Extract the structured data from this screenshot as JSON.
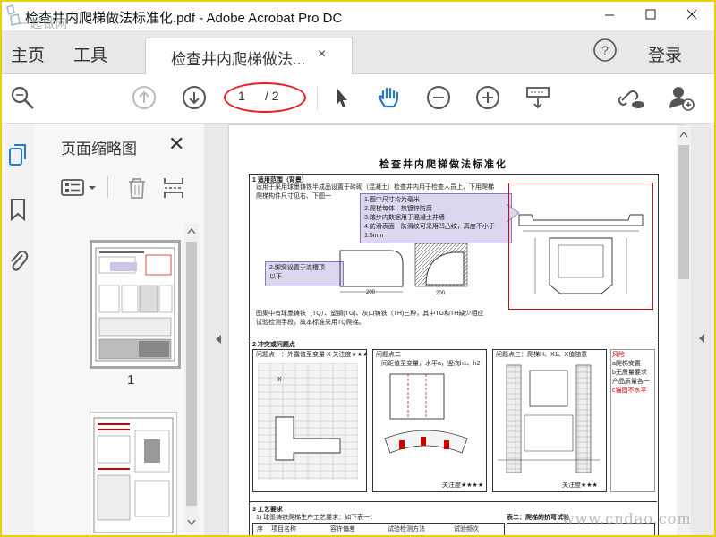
{
  "window": {
    "title": "检查井内爬梯做法标准化.pdf - Adobe Acrobat Pro DC"
  },
  "watermark_corner": "一起做网",
  "nav": {
    "home": "主页",
    "tools": "工具"
  },
  "tab": {
    "label": "检查井内爬梯做法...",
    "close": "×"
  },
  "header": {
    "help": "?",
    "login": "登录"
  },
  "toolbar": {
    "page_current": "1",
    "page_total": "/ 2"
  },
  "panel": {
    "title": "页面缩略图",
    "close": "✕",
    "thumb1_number": "1"
  },
  "document": {
    "title": "检查井内爬梯做法标准化",
    "sec1": "1  适用范围（背景）",
    "sec1_line1": "适用于采用球墨铸铁半成品设置于砖砌（混凝土）检查井内用于检查人员上、下用爬梯",
    "sec1_line2": "爬梯构件尺寸见右、下图一",
    "callout1": [
      "1.图中尺寸均为毫米",
      "2.爬梯每体：热镀锌防腐",
      "3.踏步内数据用于混凝土井墙",
      "4.防滑表面，防滑纹可采用凹凸纹，高度不小于1.5mm"
    ],
    "callout2": [
      "2.脚窝设置于流槽顶",
      "以下"
    ],
    "dim1": "200",
    "dim2": "200",
    "note_line1": "图集中有球墨铸铁（TQ）、塑钢(TG)、灰口铸铁（TH)三种，其中TG和TH缺少相应",
    "note_line2": "试验检测手段，故本标准采用TQ爬梯。",
    "sec2": "2  冲突或问题点",
    "p1_title": "问题点一：外露值至变量 X  关注度★★★",
    "p2_title": "问题点二",
    "p2_desc": "间距值至变量，水平a，竖向h1、h2",
    "p3_title": "问题点三：爬梯H、X1、X值随意",
    "p4_title": "风险",
    "p4_lines": [
      "a爬梯安置",
      "b无质量要求",
      "产品质量各一",
      "c锚固不水平"
    ],
    "p2_star": "关注度★★★★",
    "p3_star": "关注度★★★",
    "sec3": "3  工艺要求",
    "sec3_line": "1) 球墨铸铁爬梯生产工艺要求：如下表一：",
    "table_heads": [
      "序",
      "项目名称",
      "容许偏差",
      "试验检测方法",
      "试验频次"
    ],
    "table2_title": "表二：爬梯的抗弯试验",
    "mark_x": "X"
  },
  "site_watermark": "www.cndao.com"
}
